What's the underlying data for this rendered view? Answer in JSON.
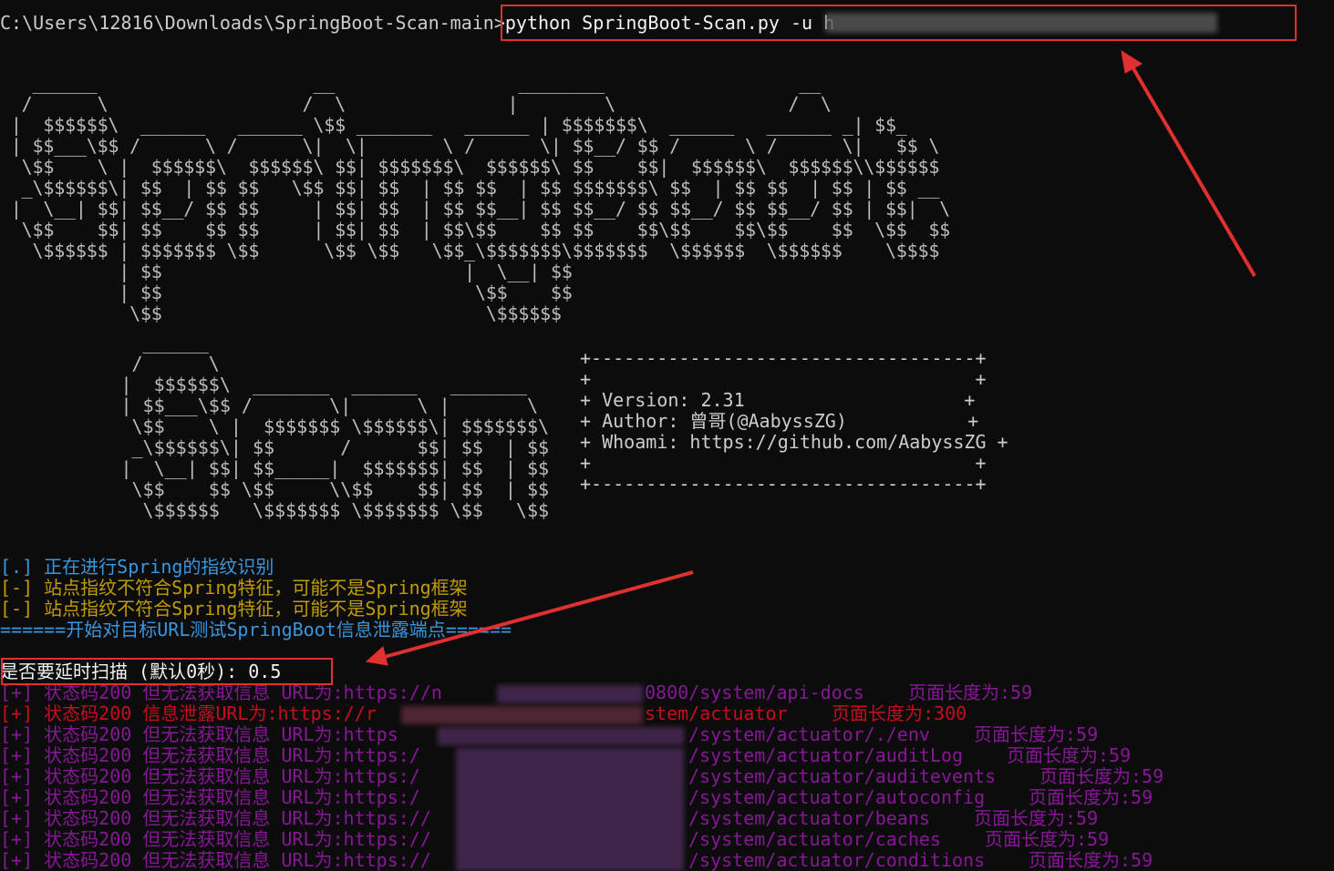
{
  "command": {
    "prompt": "C:\\Users\\12816\\Downloads\\SpringBoot-Scan-main>",
    "text": "python SpringBoot-Scan.py -u h"
  },
  "banner": {
    "version": "+ Version: 2.31                    +",
    "author": "+ Author: 曾哥(@AabyssZG)           +",
    "whoami": "+ Whoami: https://github.com/AabyssZG +",
    "border": "+-----------------------------------+",
    "empty": "+                                   +"
  },
  "messages": {
    "m1": "[.] 正在进行Spring的指纹识别",
    "m2": "[-] 站点指纹不符合Spring特征，可能不是Spring框架",
    "m3": "[-] 站点指纹不符合Spring特征，可能不是Spring框架",
    "m4": "======开始对目标URL测试SpringBoot信息泄露端点======",
    "prompt_delay": "是否要延时扫描 (默认0秒): 0.5"
  },
  "results": [
    {
      "prefix": "[+] 状态码200 但无法获取信息 URL为:https://n",
      "path": "0800/system/api-docs",
      "len": "页面长度为:59"
    },
    {
      "prefix": "[+] 状态码200 信息泄露URL为:https://r",
      "path": "stem/actuator",
      "len": "页面长度为:300"
    },
    {
      "prefix": "[+] 状态码200 但无法获取信息 URL为:https",
      "path": "/system/actuator/./env",
      "len": "页面长度为:59"
    },
    {
      "prefix": "[+] 状态码200 但无法获取信息 URL为:https:/",
      "path": "/system/actuator/auditLog",
      "len": "页面长度为:59"
    },
    {
      "prefix": "[+] 状态码200 但无法获取信息 URL为:https:/",
      "path": "/system/actuator/auditevents",
      "len": "页面长度为:59"
    },
    {
      "prefix": "[+] 状态码200 但无法获取信息 URL为:https:/",
      "path": "/system/actuator/autoconfig",
      "len": "页面长度为:59"
    },
    {
      "prefix": "[+] 状态码200 但无法获取信息 URL为:https://",
      "path": "/system/actuator/beans",
      "len": "页面长度为:59"
    },
    {
      "prefix": "[+] 状态码200 但无法获取信息 URL为:https://",
      "path": "/system/actuator/caches",
      "len": "页面长度为:59"
    },
    {
      "prefix": "[+] 状态码200 但无法获取信息 URL为:https://",
      "path": "/system/actuator/conditions",
      "len": "页面长度为:59"
    }
  ],
  "colors": {
    "highlight": "#e03030",
    "info": "#3a96dd",
    "warn": "#c19c00",
    "leak": "#c50f1f",
    "ok": "#881798"
  }
}
